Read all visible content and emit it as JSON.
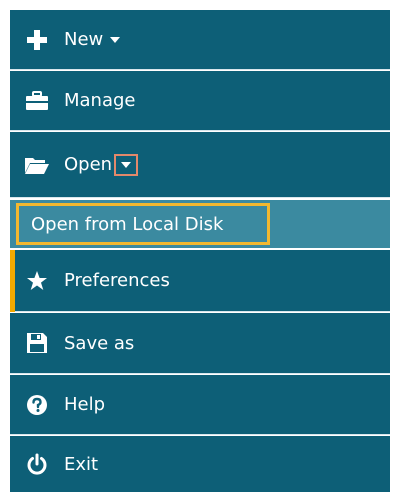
{
  "menu": {
    "items": [
      {
        "id": "new",
        "label": "New",
        "icon": "plus-icon",
        "has_dropdown": true
      },
      {
        "id": "manage",
        "label": "Manage",
        "icon": "briefcase-icon",
        "has_dropdown": false
      },
      {
        "id": "open",
        "label": "Open",
        "icon": "folder-open-icon",
        "has_dropdown": true
      },
      {
        "id": "preferences",
        "label": "Preferences",
        "icon": "star-icon",
        "has_dropdown": false
      },
      {
        "id": "save_as",
        "label": "Save as",
        "icon": "floppy-disk-icon",
        "has_dropdown": false
      },
      {
        "id": "help",
        "label": "Help",
        "icon": "question-circle-icon",
        "has_dropdown": false
      },
      {
        "id": "exit",
        "label": "Exit",
        "icon": "power-icon",
        "has_dropdown": false
      }
    ],
    "open_submenu": {
      "label": "Open from Local Disk"
    }
  },
  "colors": {
    "menu_bg": "#0d5f77",
    "submenu_bg": "#3b8aa0",
    "highlight_border": "#f2b830",
    "caret_highlight": "#e2896b",
    "active_accent": "#f2a900",
    "text": "#ffffff"
  }
}
